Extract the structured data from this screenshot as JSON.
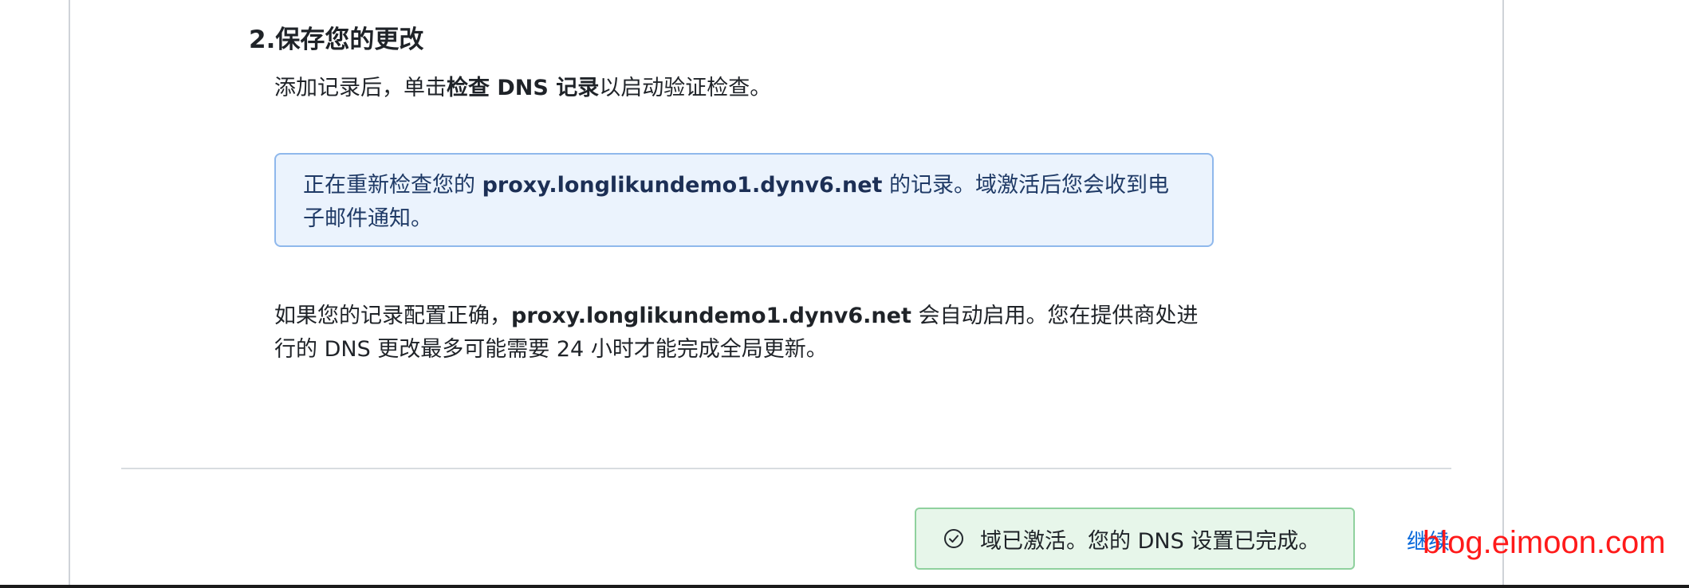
{
  "step": {
    "title": "2.保存您的更改",
    "desc_prefix": "添加记录后，单击",
    "desc_bold": "检查 DNS 记录",
    "desc_suffix": "以启动验证检查。"
  },
  "info_box": {
    "prefix": "正在重新检查您的 ",
    "domain": "proxy.longlikundemo1.dynv6.net",
    "suffix": " 的记录。域激活后您会收到电子邮件通知。"
  },
  "paragraph": {
    "prefix": "如果您的记录配置正确，",
    "domain": "proxy.longlikundemo1.dynv6.net",
    "suffix": " 会自动启用。您在提供商处进行的 DNS 更改最多可能需要 24 小时才能完成全局更新。"
  },
  "toast": {
    "icon": "check-circle-icon",
    "message": "域已激活。您的 DNS 设置已完成。"
  },
  "continue_label": "继续",
  "watermark": "blog.eimoon.com",
  "colors": {
    "info_bg": "#ebf3fd",
    "info_border": "#8fb8ec",
    "success_bg": "#e7f6ea",
    "success_border": "#8fd19e",
    "link": "#0969da",
    "watermark": "#ff1a1a"
  }
}
